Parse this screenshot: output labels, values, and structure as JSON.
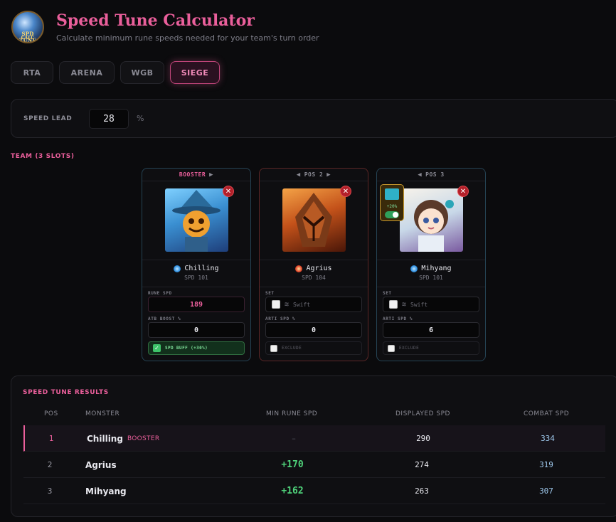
{
  "header": {
    "logo_line1": "SPD TUNE",
    "logo_line2": "CALC",
    "title": "Speed Tune Calculator",
    "subtitle": "Calculate minimum rune speeds needed for your team's turn order"
  },
  "tabs": [
    {
      "label": "RTA",
      "active": false
    },
    {
      "label": "ARENA",
      "active": false
    },
    {
      "label": "WGB",
      "active": false
    },
    {
      "label": "SIEGE",
      "active": true
    }
  ],
  "speed_lead": {
    "label": "SPEED LEAD",
    "value": "28",
    "unit": "%"
  },
  "team": {
    "label": "TEAM (3 SLOTS)",
    "cards": [
      {
        "header": "BOOSTER",
        "name": "Chilling",
        "element": "water",
        "base_spd": "SPD 101",
        "rune_spd_label": "RUNE SPD",
        "rune_spd": "189",
        "atb_label": "ATB BOOST %",
        "atb": "0",
        "buff_label": "SPD BUFF (+30%)",
        "buff_checked": true
      },
      {
        "header": "POS 2",
        "name": "Agrius",
        "element": "fire",
        "base_spd": "SPD 104",
        "set_label": "SET",
        "set_value": "Swift",
        "arti_label": "ARTI SPD %",
        "arti_spd": "0",
        "exclude_label": "EXCLUDE"
      },
      {
        "header": "POS 3",
        "name": "Mihyang",
        "element": "water",
        "base_spd": "SPD 101",
        "artifact_bonus": "+20%",
        "set_label": "SET",
        "set_value": "Swift",
        "arti_label": "ARTI SPD %",
        "arti_spd": "6",
        "exclude_label": "EXCLUDE"
      }
    ]
  },
  "results": {
    "title": "SPEED TUNE RESULTS",
    "columns": [
      "POS",
      "MONSTER",
      "MIN RUNE SPD",
      "DISPLAYED SPD",
      "COMBAT SPD"
    ],
    "booster_tag": "BOOSTER",
    "rows": [
      {
        "pos": "1",
        "monster": "Chilling",
        "min_rune": "–",
        "displayed": "290",
        "combat": "334"
      },
      {
        "pos": "2",
        "monster": "Agrius",
        "min_rune": "+170",
        "displayed": "274",
        "combat": "319"
      },
      {
        "pos": "3",
        "monster": "Mihyang",
        "min_rune": "+162",
        "displayed": "263",
        "combat": "307"
      }
    ]
  },
  "colors": {
    "accent": "#ea5f9b",
    "gain": "#4fd27a",
    "combat": "#9ec8ec"
  }
}
